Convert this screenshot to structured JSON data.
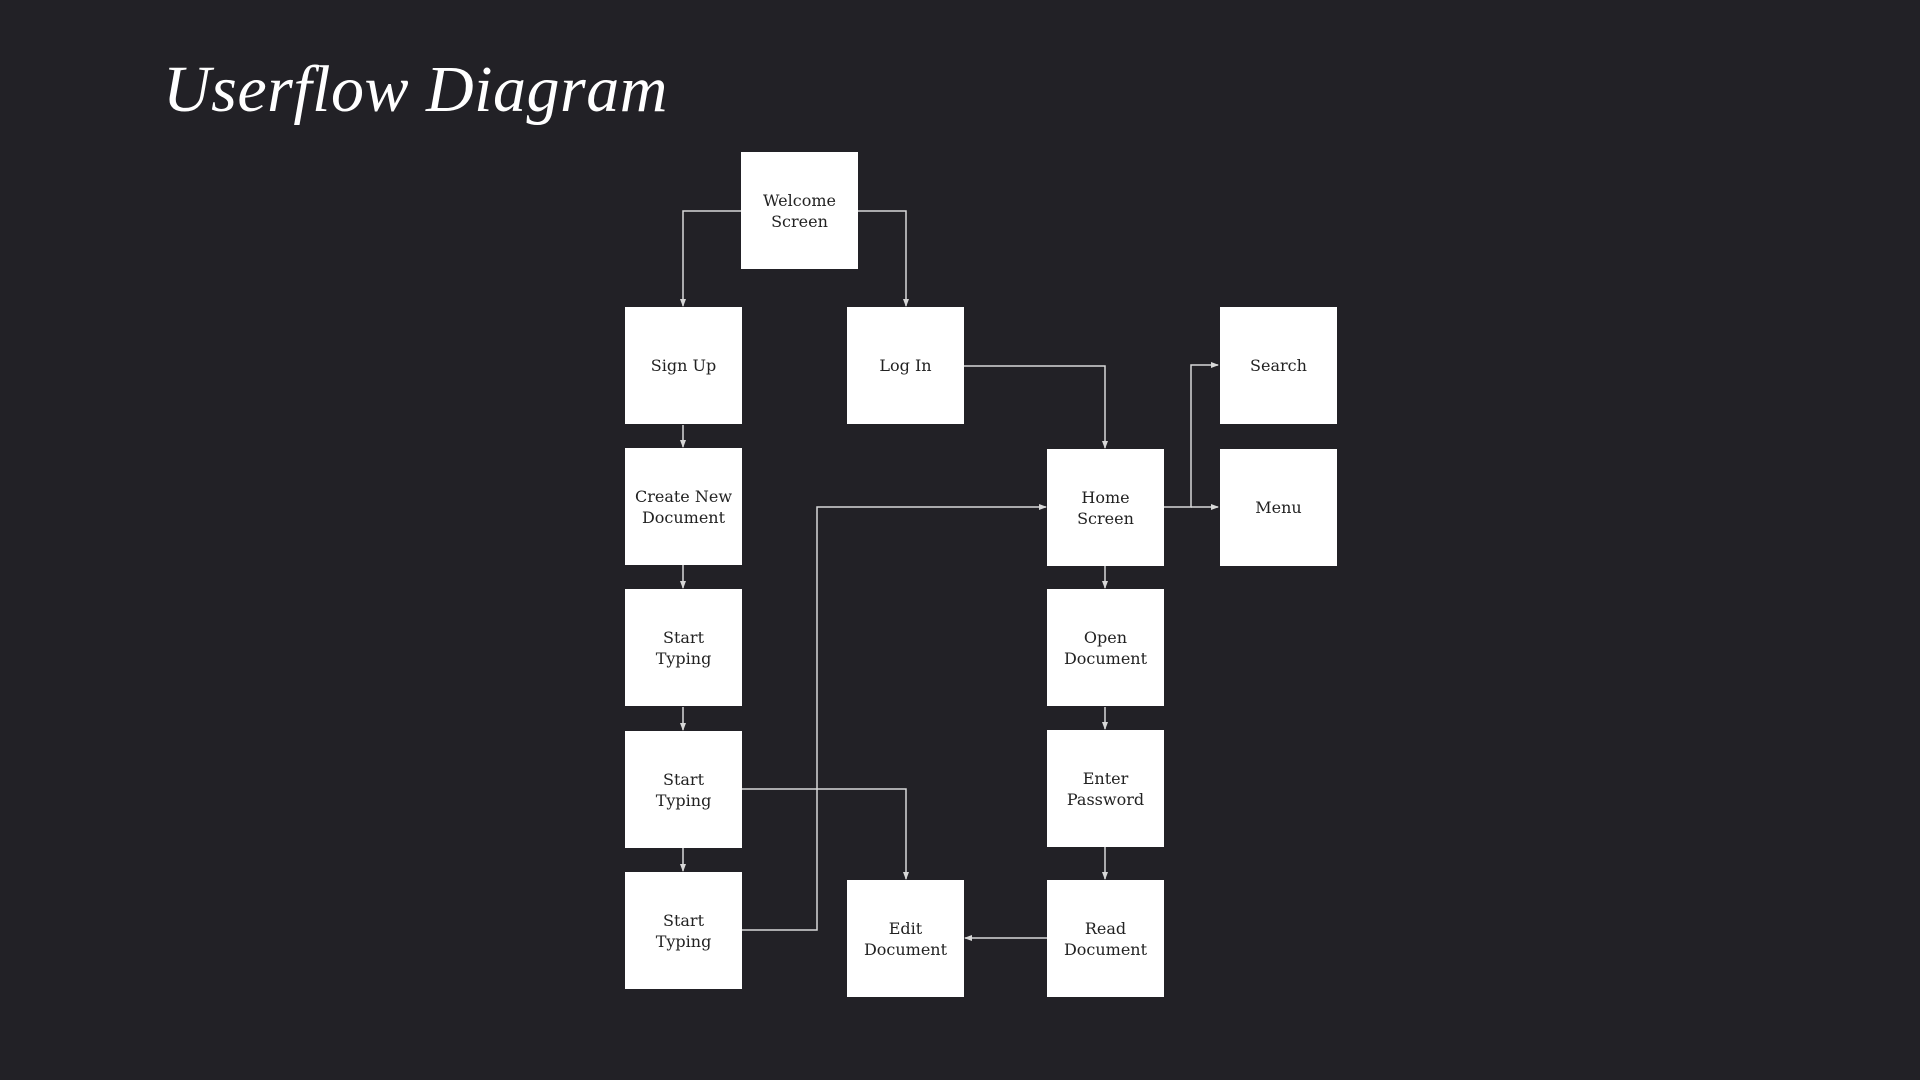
{
  "title": "Userflow Diagram",
  "colors": {
    "background": "#222126",
    "node_fill": "#ffffff",
    "node_text": "#222222",
    "connector": "#d8d8d8"
  },
  "nodes": {
    "welcome": "Welcome\nScreen",
    "signup": "Sign Up",
    "login": "Log In",
    "create_doc": "Create New\nDocument",
    "start_typing_1": "Start\nTyping",
    "start_typing_2": "Start\nTyping",
    "start_typing_3": "Start\nTyping",
    "home": "Home\nScreen",
    "search": "Search",
    "menu": "Menu",
    "open_doc": "Open\nDocument",
    "enter_password": "Enter\nPassword",
    "read_doc": "Read\nDocument",
    "edit_doc": "Edit\nDocument"
  },
  "edges": [
    {
      "from": "Welcome Screen",
      "to": "Sign Up"
    },
    {
      "from": "Welcome Screen",
      "to": "Log In"
    },
    {
      "from": "Sign Up",
      "to": "Create New Document"
    },
    {
      "from": "Create New Document",
      "to": "Start Typing"
    },
    {
      "from": "Start Typing",
      "to": "Start Typing"
    },
    {
      "from": "Start Typing",
      "to": "Start Typing"
    },
    {
      "from": "Start Typing (2)",
      "to": "Edit Document"
    },
    {
      "from": "Start Typing (3)",
      "to": "Home Screen"
    },
    {
      "from": "Log In",
      "to": "Home Screen"
    },
    {
      "from": "Home Screen",
      "to": "Search"
    },
    {
      "from": "Home Screen",
      "to": "Menu"
    },
    {
      "from": "Home Screen",
      "to": "Open Document"
    },
    {
      "from": "Open Document",
      "to": "Enter Password"
    },
    {
      "from": "Enter Password",
      "to": "Read Document"
    },
    {
      "from": "Read Document",
      "to": "Edit Document"
    }
  ]
}
